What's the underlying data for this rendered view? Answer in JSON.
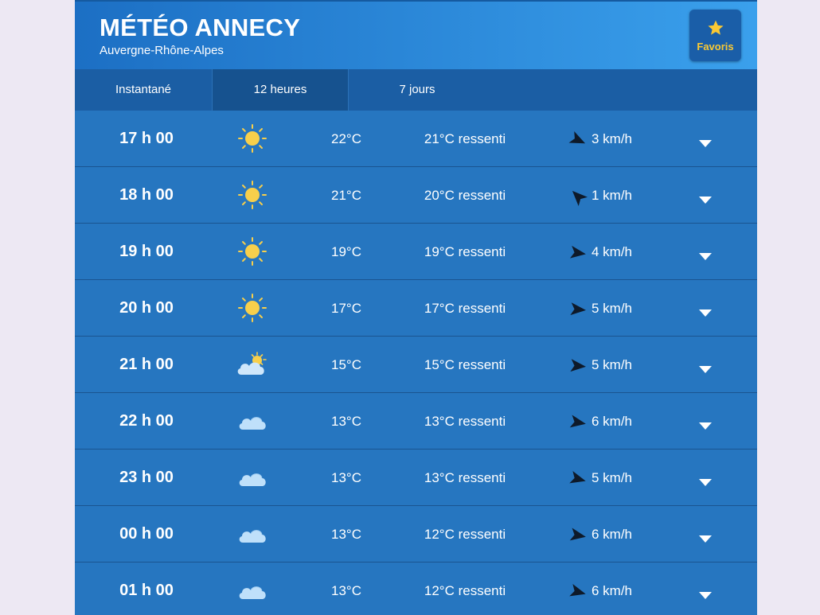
{
  "header": {
    "city": "MÉTÉO ANNECY",
    "region": "Auvergne-Rhône-Alpes",
    "favorites_label": "Favoris",
    "favorites_icon": "star-icon",
    "favorites_color": "#f9c934"
  },
  "tabs": [
    {
      "label": "Instantané"
    },
    {
      "label": "12 heures",
      "active": true
    },
    {
      "label": "7 jours"
    }
  ],
  "rows": [
    {
      "time": "17 h 00",
      "icon": "sun-icon",
      "temp": "22°C",
      "feel": "21°C ressenti",
      "wind_dir_deg": 115,
      "wind": "3 km/h"
    },
    {
      "time": "18 h 00",
      "icon": "sun-icon",
      "temp": "21°C",
      "feel": "20°C ressenti",
      "wind_dir_deg": -45,
      "wind": "1 km/h"
    },
    {
      "time": "19 h 00",
      "icon": "sun-icon",
      "temp": "19°C",
      "feel": "19°C ressenti",
      "wind_dir_deg": 98,
      "wind": "4 km/h"
    },
    {
      "time": "20 h 00",
      "icon": "sun-icon",
      "temp": "17°C",
      "feel": "17°C ressenti",
      "wind_dir_deg": 95,
      "wind": "5 km/h"
    },
    {
      "time": "21 h 00",
      "icon": "sun-cloud-icon",
      "temp": "15°C",
      "feel": "15°C ressenti",
      "wind_dir_deg": 95,
      "wind": "5 km/h"
    },
    {
      "time": "22 h 00",
      "icon": "cloud-icon",
      "temp": "13°C",
      "feel": "13°C ressenti",
      "wind_dir_deg": 100,
      "wind": "6 km/h"
    },
    {
      "time": "23 h 00",
      "icon": "cloud-icon",
      "temp": "13°C",
      "feel": "13°C ressenti",
      "wind_dir_deg": 105,
      "wind": "5 km/h"
    },
    {
      "time": "00 h 00",
      "icon": "cloud-icon",
      "temp": "13°C",
      "feel": "12°C ressenti",
      "wind_dir_deg": 100,
      "wind": "6 km/h"
    },
    {
      "time": "01 h 00",
      "icon": "cloud-icon",
      "temp": "13°C",
      "feel": "12°C ressenti",
      "wind_dir_deg": 105,
      "wind": "6 km/h"
    }
  ],
  "colors": {
    "background": "#ede8f3",
    "panel": "#2676c0",
    "tabs_bar": "#1b5ea4",
    "active_tab": "#16528f",
    "sun": "#f7cf4b",
    "cloud": "#bfe0fa",
    "arrow": "#0e1a2a"
  }
}
